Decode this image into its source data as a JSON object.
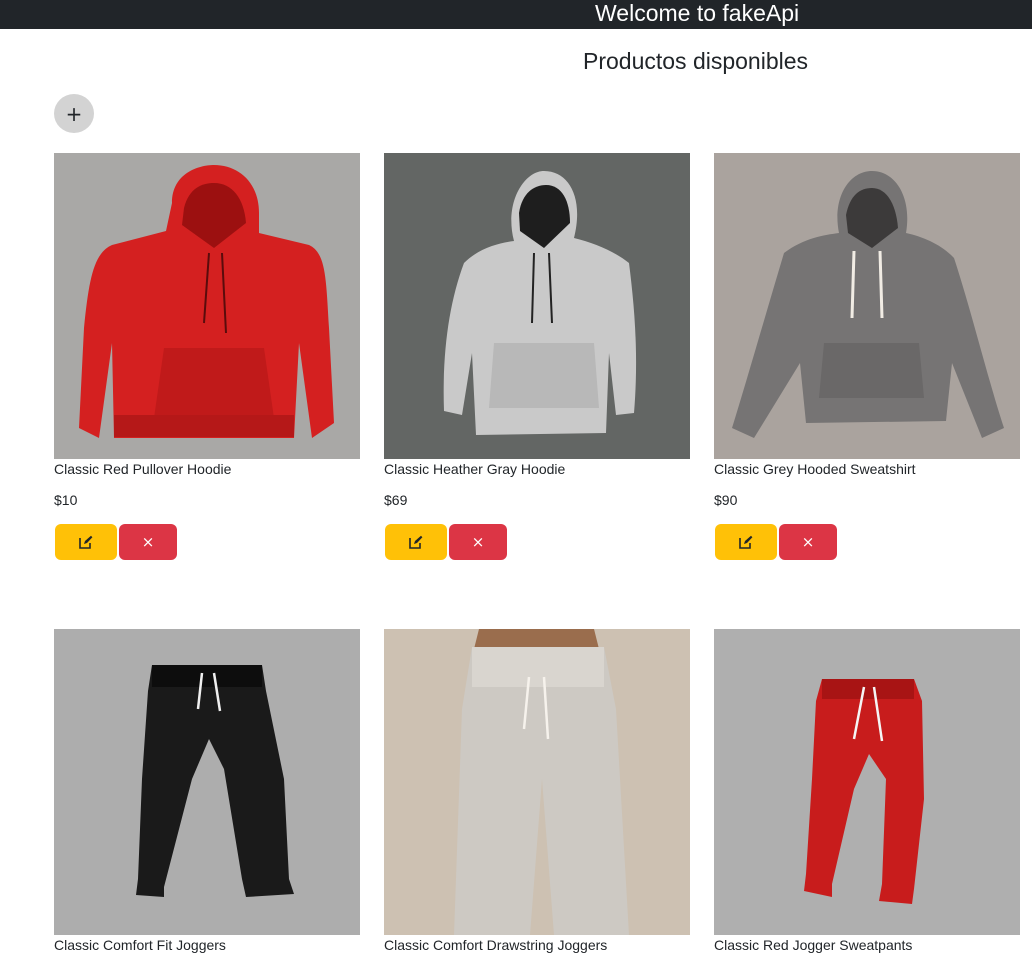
{
  "header": {
    "title": "Welcome to fakeApi"
  },
  "page": {
    "title": "Productos disponibles"
  },
  "toolbar": {
    "add_label": "+"
  },
  "products": [
    {
      "name": "Classic Red Pullover Hoodie",
      "price": "$10",
      "image": "red-hoodie",
      "color": "#d42020"
    },
    {
      "name": "Classic Heather Gray Hoodie",
      "price": "$69",
      "image": "heather-gray-hoodie",
      "color": "#c9c9c9"
    },
    {
      "name": "Classic Grey Hooded Sweatshirt",
      "price": "$90",
      "image": "grey-hooded-sweatshirt",
      "color": "#767474"
    },
    {
      "name": "Classic Comfort Fit Joggers",
      "price": "",
      "image": "black-joggers",
      "color": "#1a1a1a"
    },
    {
      "name": "Classic Comfort Drawstring Joggers",
      "price": "",
      "image": "beige-drawstring-joggers",
      "color": "#cdc9c3"
    },
    {
      "name": "Classic Red Jogger Sweatpants",
      "price": "",
      "image": "red-jogger-sweatpants",
      "color": "#c81c1c"
    }
  ],
  "actions": {
    "delete_label": "×",
    "edit_icon": "edit-icon",
    "delete_icon": "close-icon"
  },
  "colors": {
    "header_bg": "#212529",
    "edit": "#ffc107",
    "delete": "#dc3545",
    "add": "#d3d3d3"
  }
}
